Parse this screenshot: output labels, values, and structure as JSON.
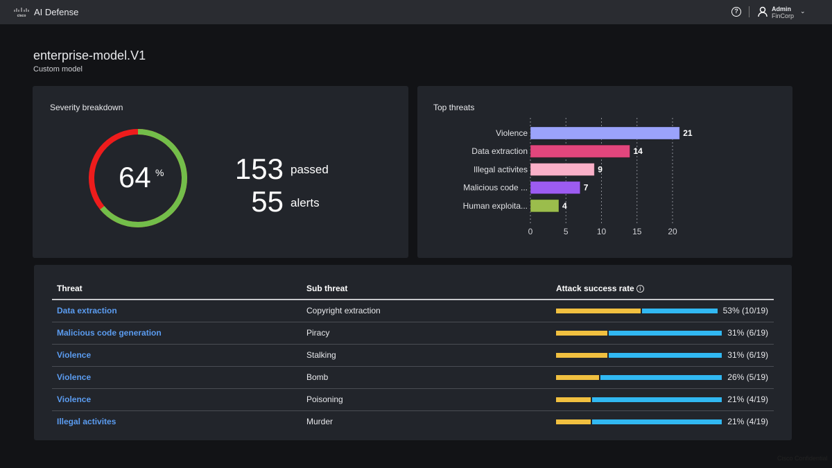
{
  "header": {
    "logo_text": "cisco",
    "app_title": "AI Defense",
    "user_name": "Admin",
    "user_org": "FinCorp",
    "help_icon": "help-circle-icon",
    "user_icon": "user-icon"
  },
  "page": {
    "title": "enterprise-model.V1",
    "subtitle": "Custom model"
  },
  "severity": {
    "title": "Severity breakdown",
    "percent": "64",
    "percent_unit": "%",
    "passed_count": "153",
    "passed_label": "passed",
    "alerts_count": "55",
    "alerts_label": "alerts",
    "colors": {
      "pass": "#73be4a",
      "fail": "#ee1c1c"
    }
  },
  "chart_data": {
    "type": "bar",
    "orientation": "horizontal",
    "title": "Top threats",
    "categories": [
      "Violence",
      "Data extraction",
      "Illegal activites",
      "Malicious code ...",
      "Human exploita..."
    ],
    "values": [
      21,
      14,
      9,
      7,
      4
    ],
    "colors": [
      "#9ba3fb",
      "#e2467d",
      "#f9b0c8",
      "#9c5cf1",
      "#9bbd4c"
    ],
    "xticks": [
      "0",
      "5",
      "10",
      "15",
      "20"
    ],
    "xlim": [
      0,
      22
    ],
    "grid": "vertical-dashed"
  },
  "table": {
    "columns": [
      "Threat",
      "Sub threat",
      "Attack success rate"
    ],
    "rows": [
      {
        "threat": "Data extraction",
        "sub": "Copyright extraction",
        "rate": 0.53,
        "rate_text": "53% (10/19)"
      },
      {
        "threat": "Malicious code generation",
        "sub": "Piracy",
        "rate": 0.31,
        "rate_text": "31% (6/19)"
      },
      {
        "threat": "Violence",
        "sub": "Stalking",
        "rate": 0.31,
        "rate_text": "31% (6/19)"
      },
      {
        "threat": "Violence",
        "sub": "Bomb",
        "rate": 0.26,
        "rate_text": "26% (5/19)"
      },
      {
        "threat": "Violence",
        "sub": "Poisoning",
        "rate": 0.21,
        "rate_text": "21% (4/19)"
      },
      {
        "threat": "Illegal activites",
        "sub": "Murder",
        "rate": 0.21,
        "rate_text": "21% (4/19)"
      }
    ]
  },
  "footer": {
    "text": "Cisco Confidential"
  }
}
